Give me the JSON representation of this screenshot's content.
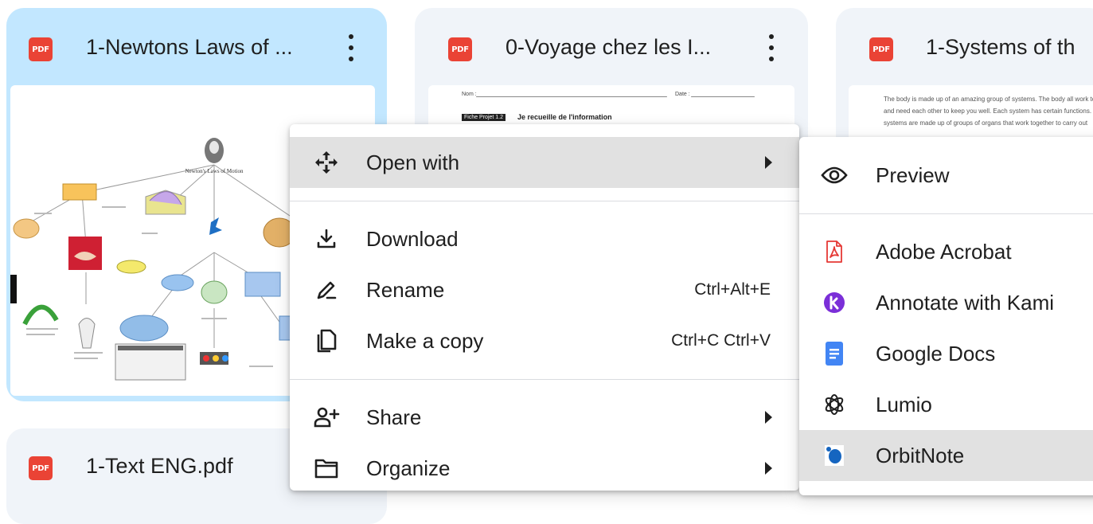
{
  "files": [
    {
      "title": "1-Newtons Laws of ...",
      "icon_label": "PDF",
      "selected": true
    },
    {
      "title": "0-Voyage chez les I...",
      "icon_label": "PDF",
      "selected": false
    },
    {
      "title": "1-Systems of th",
      "icon_label": "PDF",
      "selected": false
    },
    {
      "title": "1-Text ENG.pdf",
      "icon_label": "PDF",
      "selected": false
    }
  ],
  "thumbs": {
    "newton": {
      "title": "Newton's Laws of Motion"
    },
    "voyage": {
      "name_label": "Nom :",
      "date_label": "Date :",
      "tag": "Fiche Projet 1.2",
      "heading": "Je recueille de l'information"
    },
    "systems": {
      "text": "The body is made up of an amazing group of systems. The body all work together and need each other to keep you well. Each system has certain functions. The systems are made up of groups of organs that work together to carry out"
    }
  },
  "context_menu": {
    "open_with": "Open with",
    "download": "Download",
    "rename": "Rename",
    "rename_shortcut": "Ctrl+Alt+E",
    "make_copy": "Make a copy",
    "make_copy_shortcut": "Ctrl+C Ctrl+V",
    "share": "Share",
    "organize": "Organize"
  },
  "submenu": {
    "preview": "Preview",
    "adobe": "Adobe Acrobat",
    "kami": "Annotate with Kami",
    "docs": "Google Docs",
    "lumio": "Lumio",
    "orbitnote": "OrbitNote"
  },
  "colors": {
    "selected_card": "#c2e7ff",
    "card": "#f0f4f9",
    "pdf_red": "#ea4335",
    "kami_purple": "#7b2fd8",
    "docs_blue": "#4285f4",
    "highlight": "#e1e1e1"
  }
}
